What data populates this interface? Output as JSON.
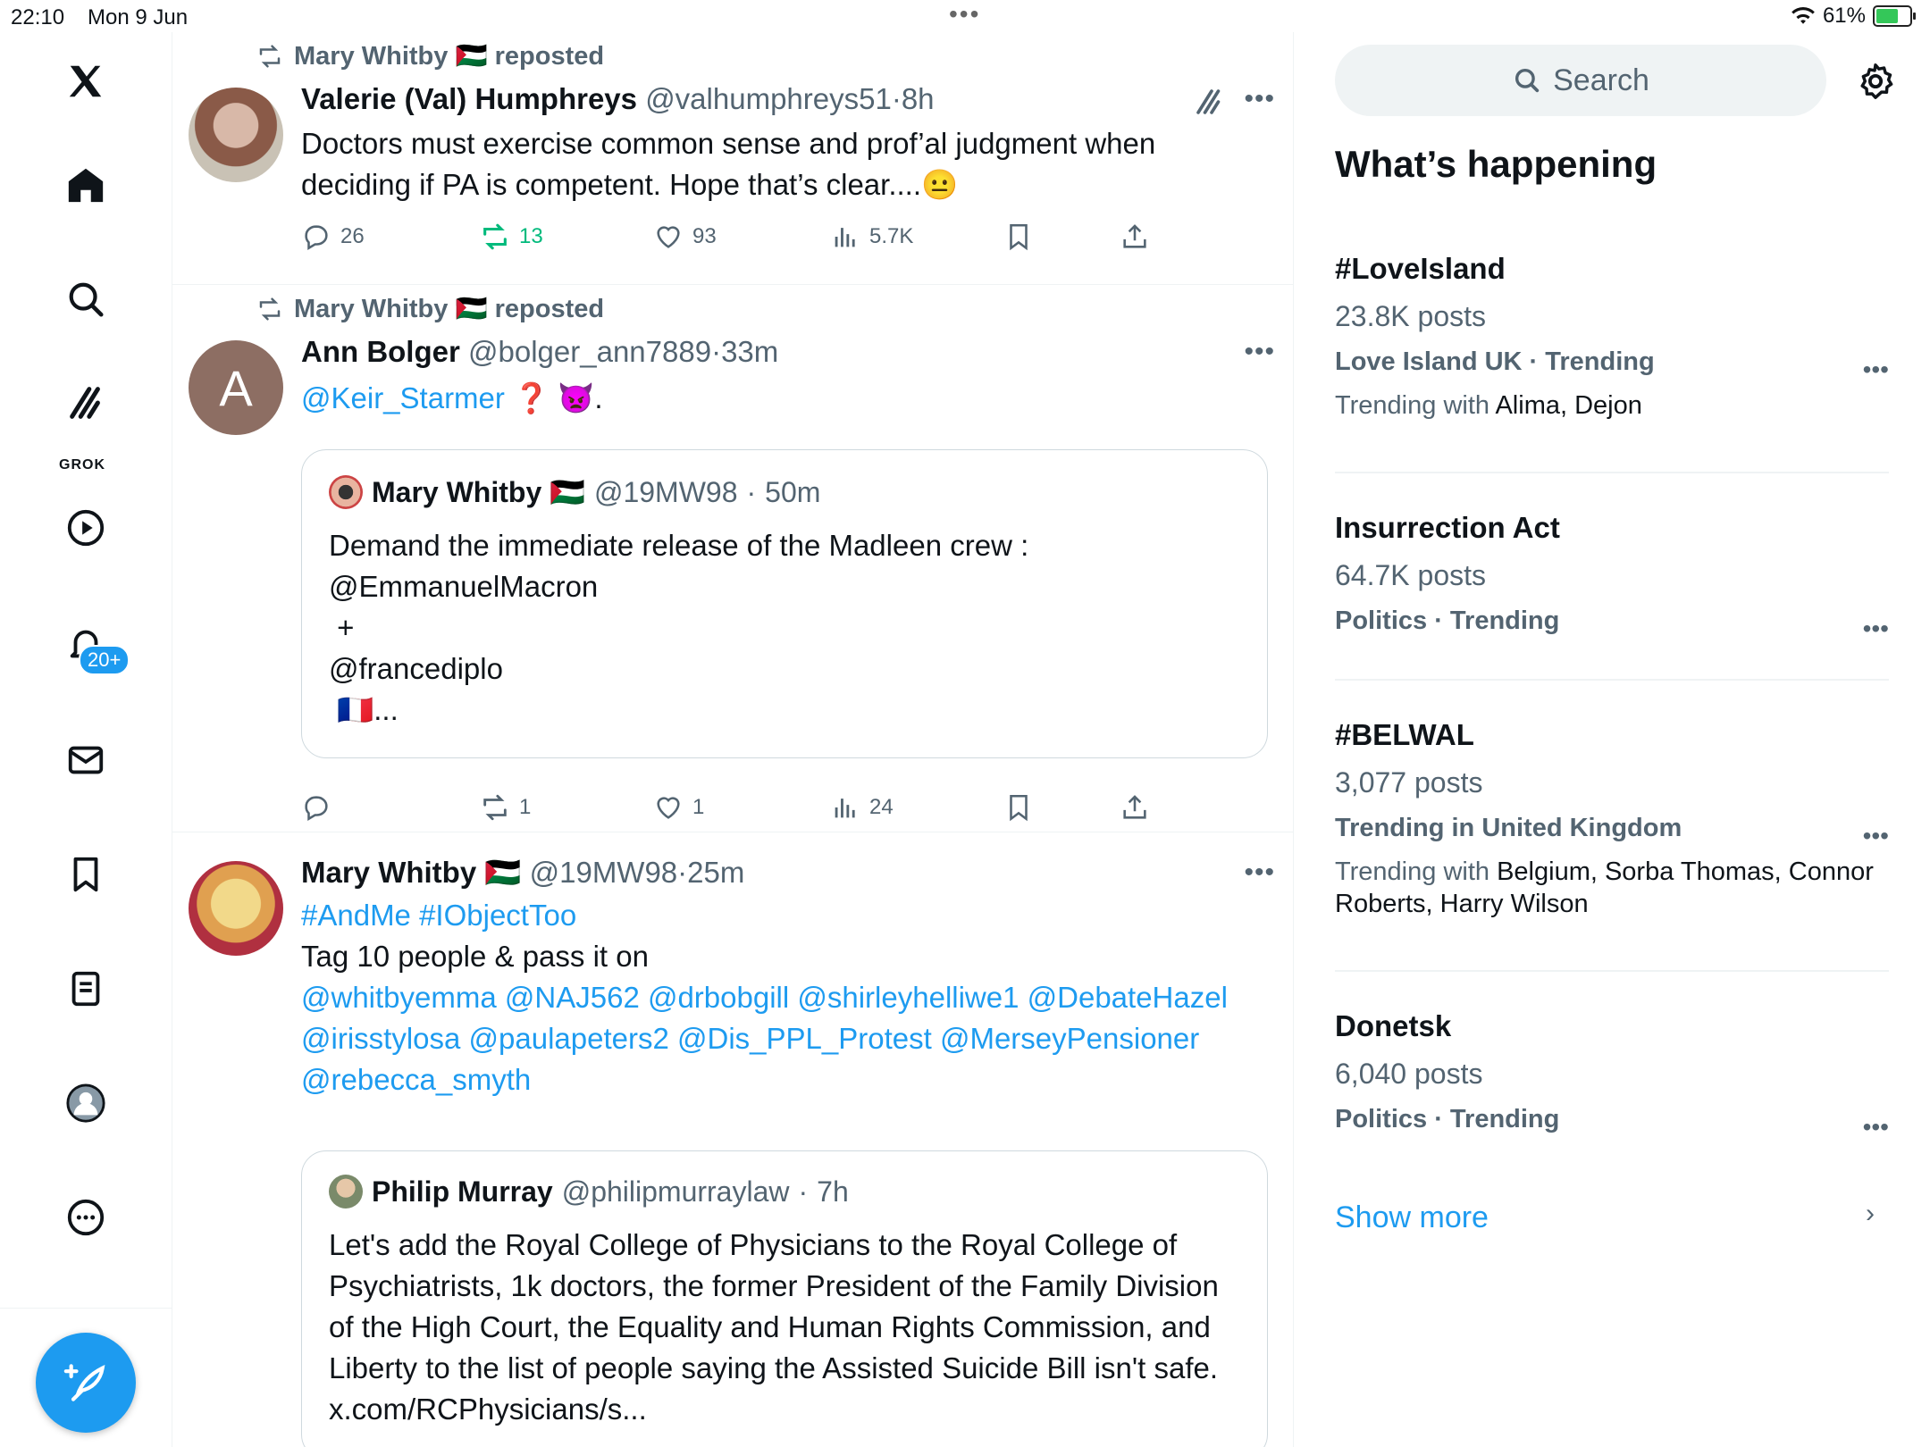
{
  "status_bar": {
    "time": "22:10",
    "date": "Mon 9 Jun",
    "battery": "61%",
    "dots": "•••"
  },
  "sidebar": {
    "items": [
      "x-logo",
      "home",
      "search",
      "grok",
      "video",
      "notifications",
      "messages",
      "bookmarks",
      "lists",
      "profile",
      "more"
    ],
    "grok_label": "GROK",
    "notifications_badge": "20+"
  },
  "feed": {
    "posts": [
      {
        "repost_text": "Mary Whitby 🇵🇸 reposted",
        "name": "Valerie (Val) Humphreys",
        "handle": "@valhumphreys51",
        "time": "8h",
        "text": "Doctors must exercise common sense and prof’al judgment when deciding if PA is competent. Hope that’s clear....",
        "emoji": "😐",
        "replies": "26",
        "reposts": "13",
        "likes": "93",
        "views": "5.7K"
      },
      {
        "repost_text": "Mary Whitby 🇵🇸 reposted",
        "name": "Ann Bolger",
        "handle": "@bolger_ann7889",
        "time": "33m",
        "avatar_letter": "A",
        "mention": "@Keir_Starmer",
        "text_tail": " ❓ 👿.",
        "quote": {
          "name": "Mary Whitby 🇵🇸",
          "handle": "@19MW98",
          "time": "50m",
          "lines": [
            "Demand the immediate release of the Madleen crew :",
            "@EmmanuelMacron",
            " +",
            "@francediplo",
            " 🇫🇷..."
          ]
        },
        "replies": "",
        "reposts": "1",
        "likes": "1",
        "views": "24"
      },
      {
        "name": "Mary Whitby 🇵🇸",
        "handle": "@19MW98",
        "time": "25m",
        "hashtags": "#AndMe #IObjectToo",
        "line2": "Tag 10 people & pass it on",
        "mentions_1": "@whitbyemma @NAJ562 @drbobgill @shirleyhelliwe1 @DebateHazel",
        "mentions_2": "@irisstylosa @paulapeters2 @Dis_PPL_Protest @MerseyPensioner",
        "mentions_3": "@rebecca_smyth",
        "quote": {
          "name": "Philip Murray",
          "handle": "@philipmurraylaw",
          "time": "7h",
          "text": "Let's add the Royal College of Physicians to the Royal College of Psychiatrists, 1k doctors, the former President of the Family Division of the High Court, the Equality and Human Rights Commission, and Liberty to the list of people saying the Assisted Suicide Bill isn't safe. x.com/RCPhysicians/s..."
        }
      }
    ]
  },
  "right": {
    "search_placeholder": "Search",
    "heading": "What’s happening",
    "trends": [
      {
        "name": "#LoveIsland",
        "posts": "23.8K posts",
        "category": "Love Island UK · Trending",
        "with_label": "Trending with ",
        "with_names": "Alima, Dejon"
      },
      {
        "name": "Insurrection Act",
        "posts": "64.7K posts",
        "category": "Politics · Trending",
        "with_label": "",
        "with_names": ""
      },
      {
        "name": "#BELWAL",
        "posts": "3,077 posts",
        "category": "Trending in United Kingdom",
        "with_label": "Trending with ",
        "with_names": "Belgium, Sorba Thomas, Connor Roberts, Harry Wilson"
      },
      {
        "name": "Donetsk",
        "posts": "6,040 posts",
        "category": "Politics · Trending",
        "with_label": "",
        "with_names": ""
      }
    ],
    "show_more": "Show more"
  },
  "colors": {
    "accent": "#1d9bf0",
    "repost_green": "#00ba7c",
    "muted": "#536471"
  }
}
